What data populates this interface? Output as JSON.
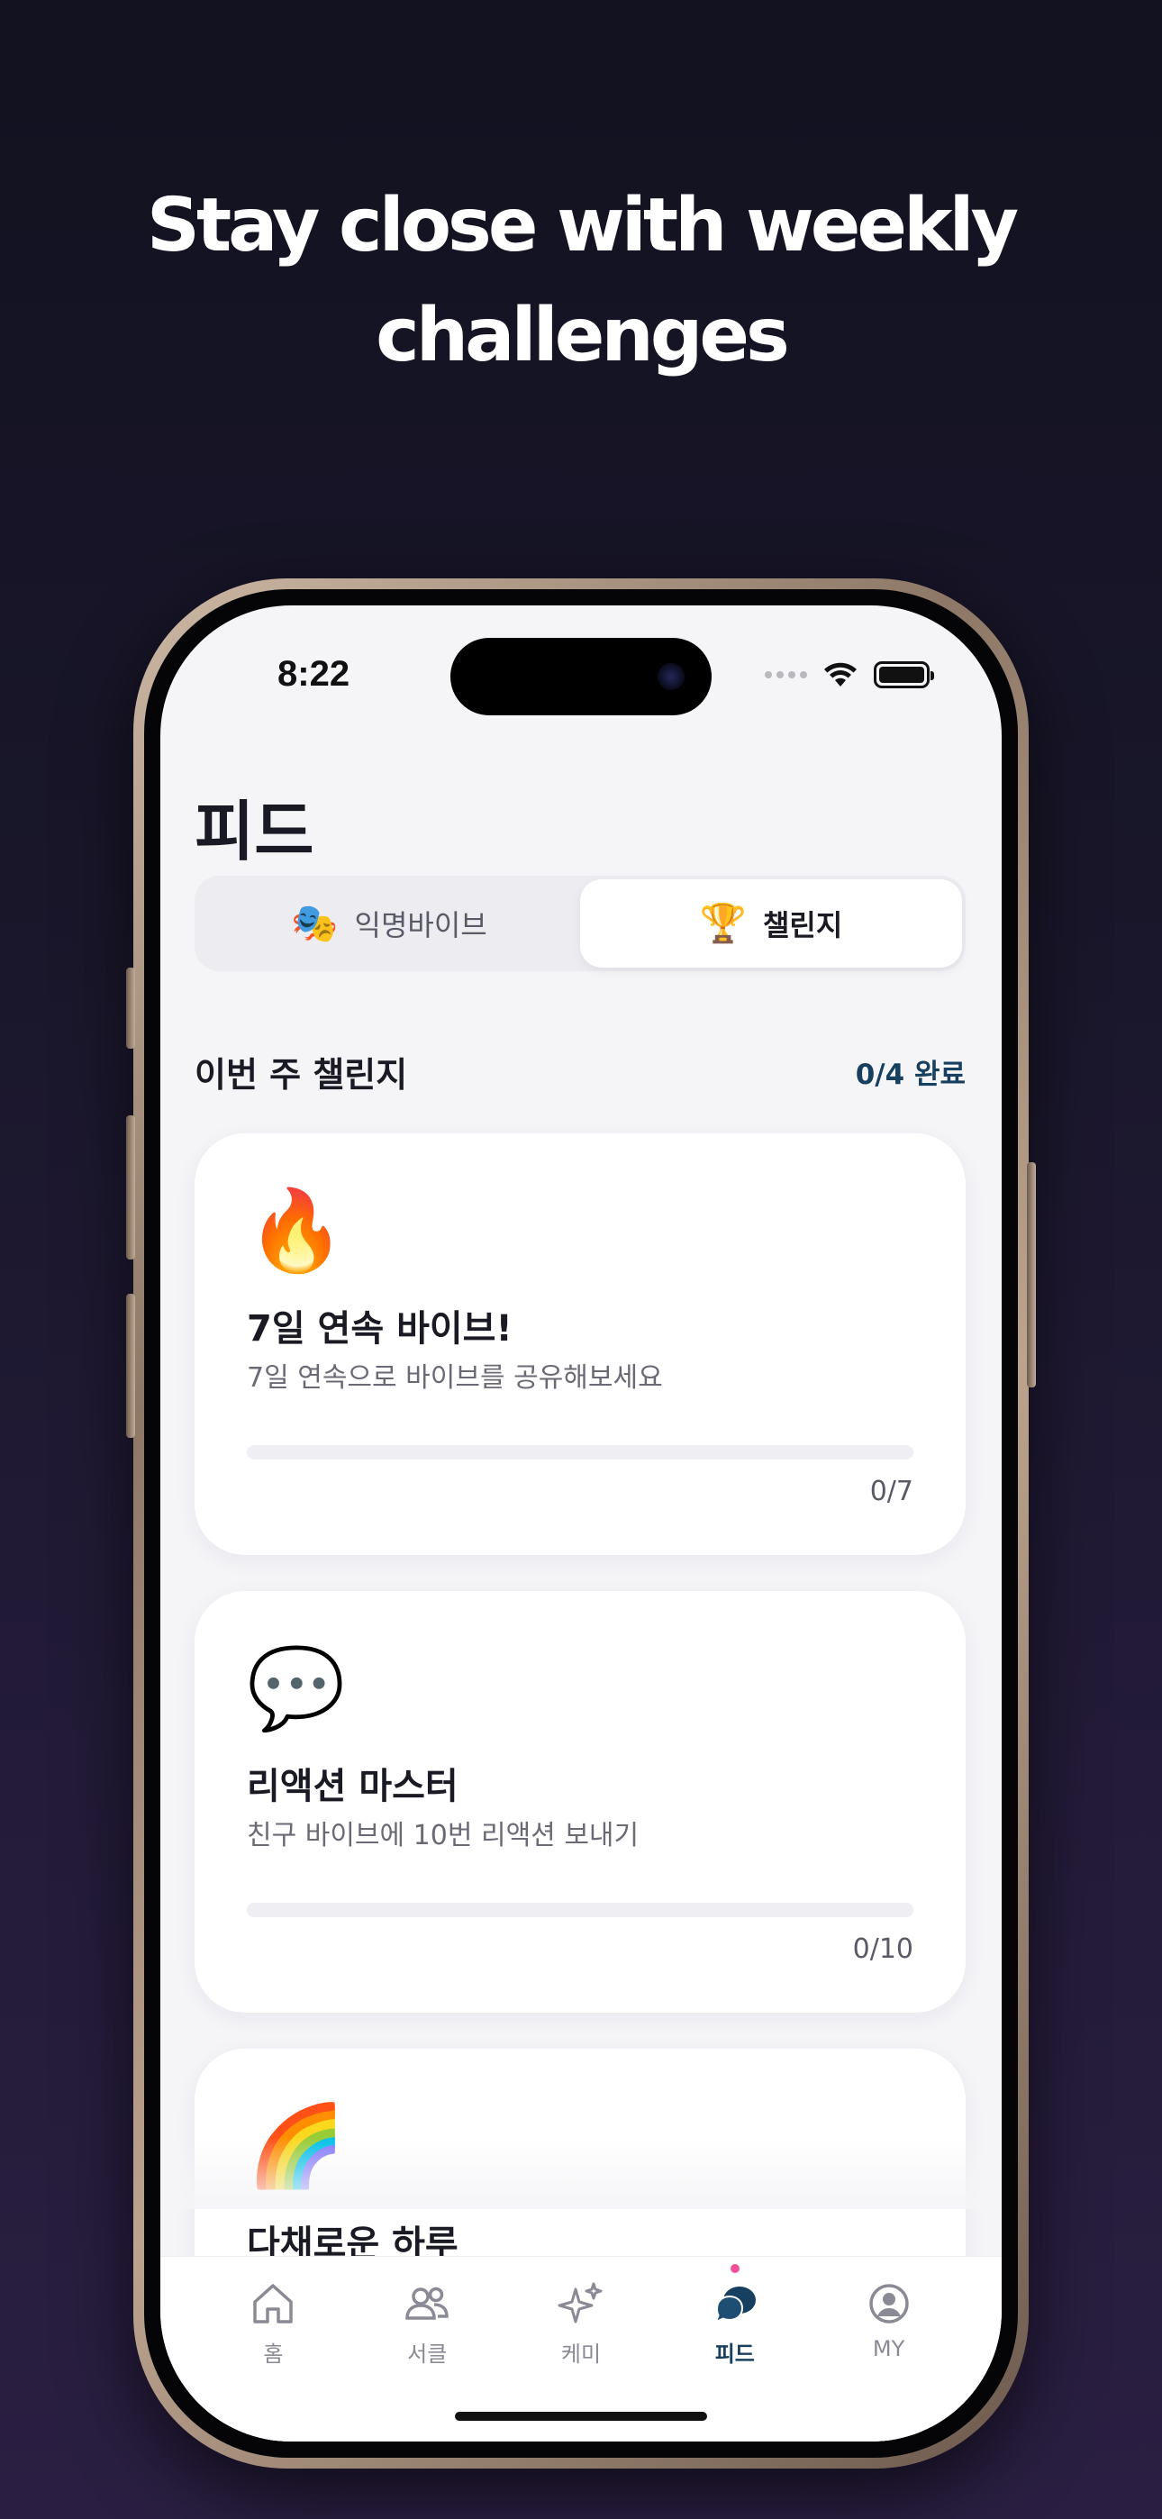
{
  "headline": {
    "line1": "Stay close with weekly",
    "line2": "challenges"
  },
  "status_bar": {
    "time": "8:22"
  },
  "page": {
    "title": "피드"
  },
  "segments": [
    {
      "emoji": "🎭",
      "label": "익명바이브",
      "active": false
    },
    {
      "emoji": "🏆",
      "label": "챌린지",
      "active": true
    }
  ],
  "section": {
    "title": "이번 주 챌린지",
    "progress": "0/4 완료"
  },
  "challenges": [
    {
      "emoji": "🔥",
      "title": "7일 연속 바이브!",
      "description": "7일 연속으로 바이브를 공유해보세요",
      "progress_text": "0/7",
      "progress": 0
    },
    {
      "emoji": "💬",
      "title": "리액션 마스터",
      "description": "친구 바이브에 10번 리액션 보내기",
      "progress_text": "0/10",
      "progress": 0
    },
    {
      "emoji": "🌈",
      "title": "다채로운 하루",
      "description": "",
      "progress_text": "",
      "progress": 0
    }
  ],
  "tabbar": [
    {
      "label": "홈",
      "icon": "home-icon",
      "active": false
    },
    {
      "label": "서클",
      "icon": "people-icon",
      "active": false
    },
    {
      "label": "케미",
      "icon": "sparkles-icon",
      "active": false
    },
    {
      "label": "피드",
      "icon": "chat-bubbles-icon",
      "active": true
    },
    {
      "label": "MY",
      "icon": "profile-icon",
      "active": false
    }
  ],
  "colors": {
    "accent": "#173f5f",
    "notification_dot": "#f0519a",
    "background": "#121220"
  }
}
